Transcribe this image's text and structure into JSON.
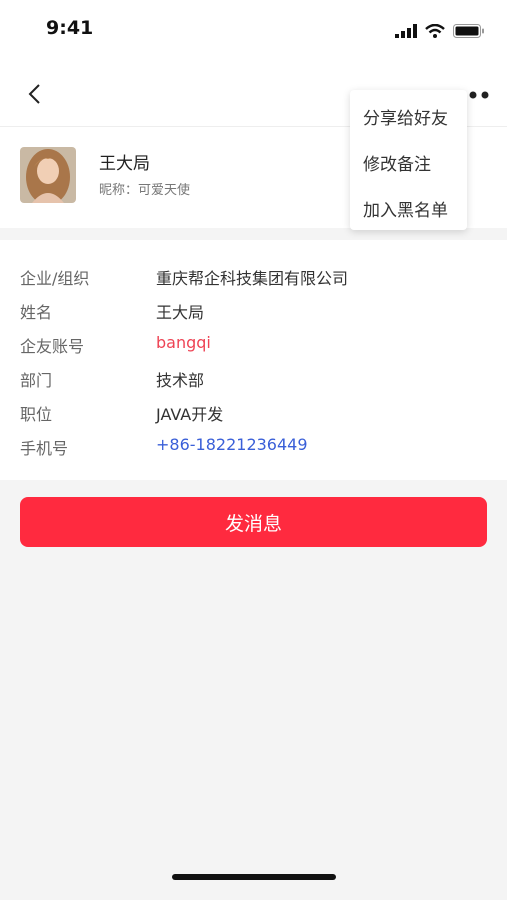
{
  "status": {
    "time": "9:41"
  },
  "nav": {
    "back_icon": "chevron-left-icon",
    "more_icon": "more-dots-icon"
  },
  "profile": {
    "name": "王大局",
    "nickname": "昵称：可爱天使"
  },
  "info": [
    {
      "label": "企业/组织",
      "value": "重庆帮企科技集团有限公司"
    },
    {
      "label": "姓名",
      "value": "王大局"
    },
    {
      "label": "企友账号",
      "value": "bangqi"
    },
    {
      "label": "部门",
      "value": "技术部"
    },
    {
      "label": "职位",
      "value": "JAVA开发"
    },
    {
      "label": "手机号",
      "value": "+86-18221236449"
    }
  ],
  "actions": {
    "send_message": "发消息"
  },
  "menu": {
    "share": "分享给好友",
    "edit_remark": "修改备注",
    "blacklist": "加入黑名单"
  },
  "colors": {
    "accent": "#ff2a3f",
    "account_text": "#ee4455",
    "phone_text": "#3a5fd8"
  }
}
